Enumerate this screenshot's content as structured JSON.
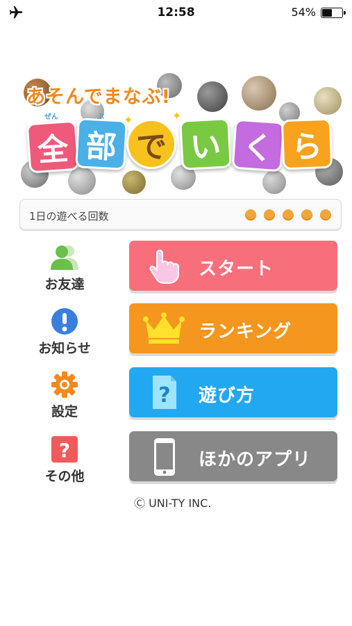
{
  "status_bar": {
    "time": "12:58",
    "battery_percent": "54%",
    "battery_level": 0.54
  },
  "logo": {
    "subtitle": "あそんでまなぶ!",
    "tiles": [
      {
        "char": "全",
        "ruby": "ぜん",
        "color": "#f05a7a"
      },
      {
        "char": "部",
        "ruby": "ぶ",
        "color": "#4ab0e6"
      },
      {
        "char": "で",
        "ruby": "",
        "color": "#f7c21e"
      },
      {
        "char": "い",
        "ruby": "",
        "color": "#7ac943"
      },
      {
        "char": "く",
        "ruby": "",
        "color": "#c46be0"
      },
      {
        "char": "ら",
        "ruby": "",
        "color": "#f8a21e"
      }
    ]
  },
  "play_counter": {
    "label": "1日の遊べる回数",
    "remaining": 5,
    "max": 5,
    "dot_color": "#f4a53a"
  },
  "side_menu": [
    {
      "label": "お友達",
      "icon": "friends-icon",
      "color": "#6ac04a"
    },
    {
      "label": "お知らせ",
      "icon": "info-icon",
      "color": "#3a7fe0"
    },
    {
      "label": "設定",
      "icon": "gear-icon",
      "color": "#f5891e"
    },
    {
      "label": "その他",
      "icon": "help-icon",
      "color": "#f05a5a"
    }
  ],
  "main_buttons": [
    {
      "label": "スタート",
      "icon": "pointing-hand-icon",
      "color": "#f76f7b"
    },
    {
      "label": "ランキング",
      "icon": "crown-icon",
      "color": "#f5961e"
    },
    {
      "label": "遊び方",
      "icon": "question-card-icon",
      "color": "#22a8f0"
    },
    {
      "label": "ほかのアプリ",
      "icon": "smartphone-icon",
      "color": "#888888"
    }
  ],
  "footer": {
    "copyright": "Ⓒ UNI-TY INC."
  }
}
